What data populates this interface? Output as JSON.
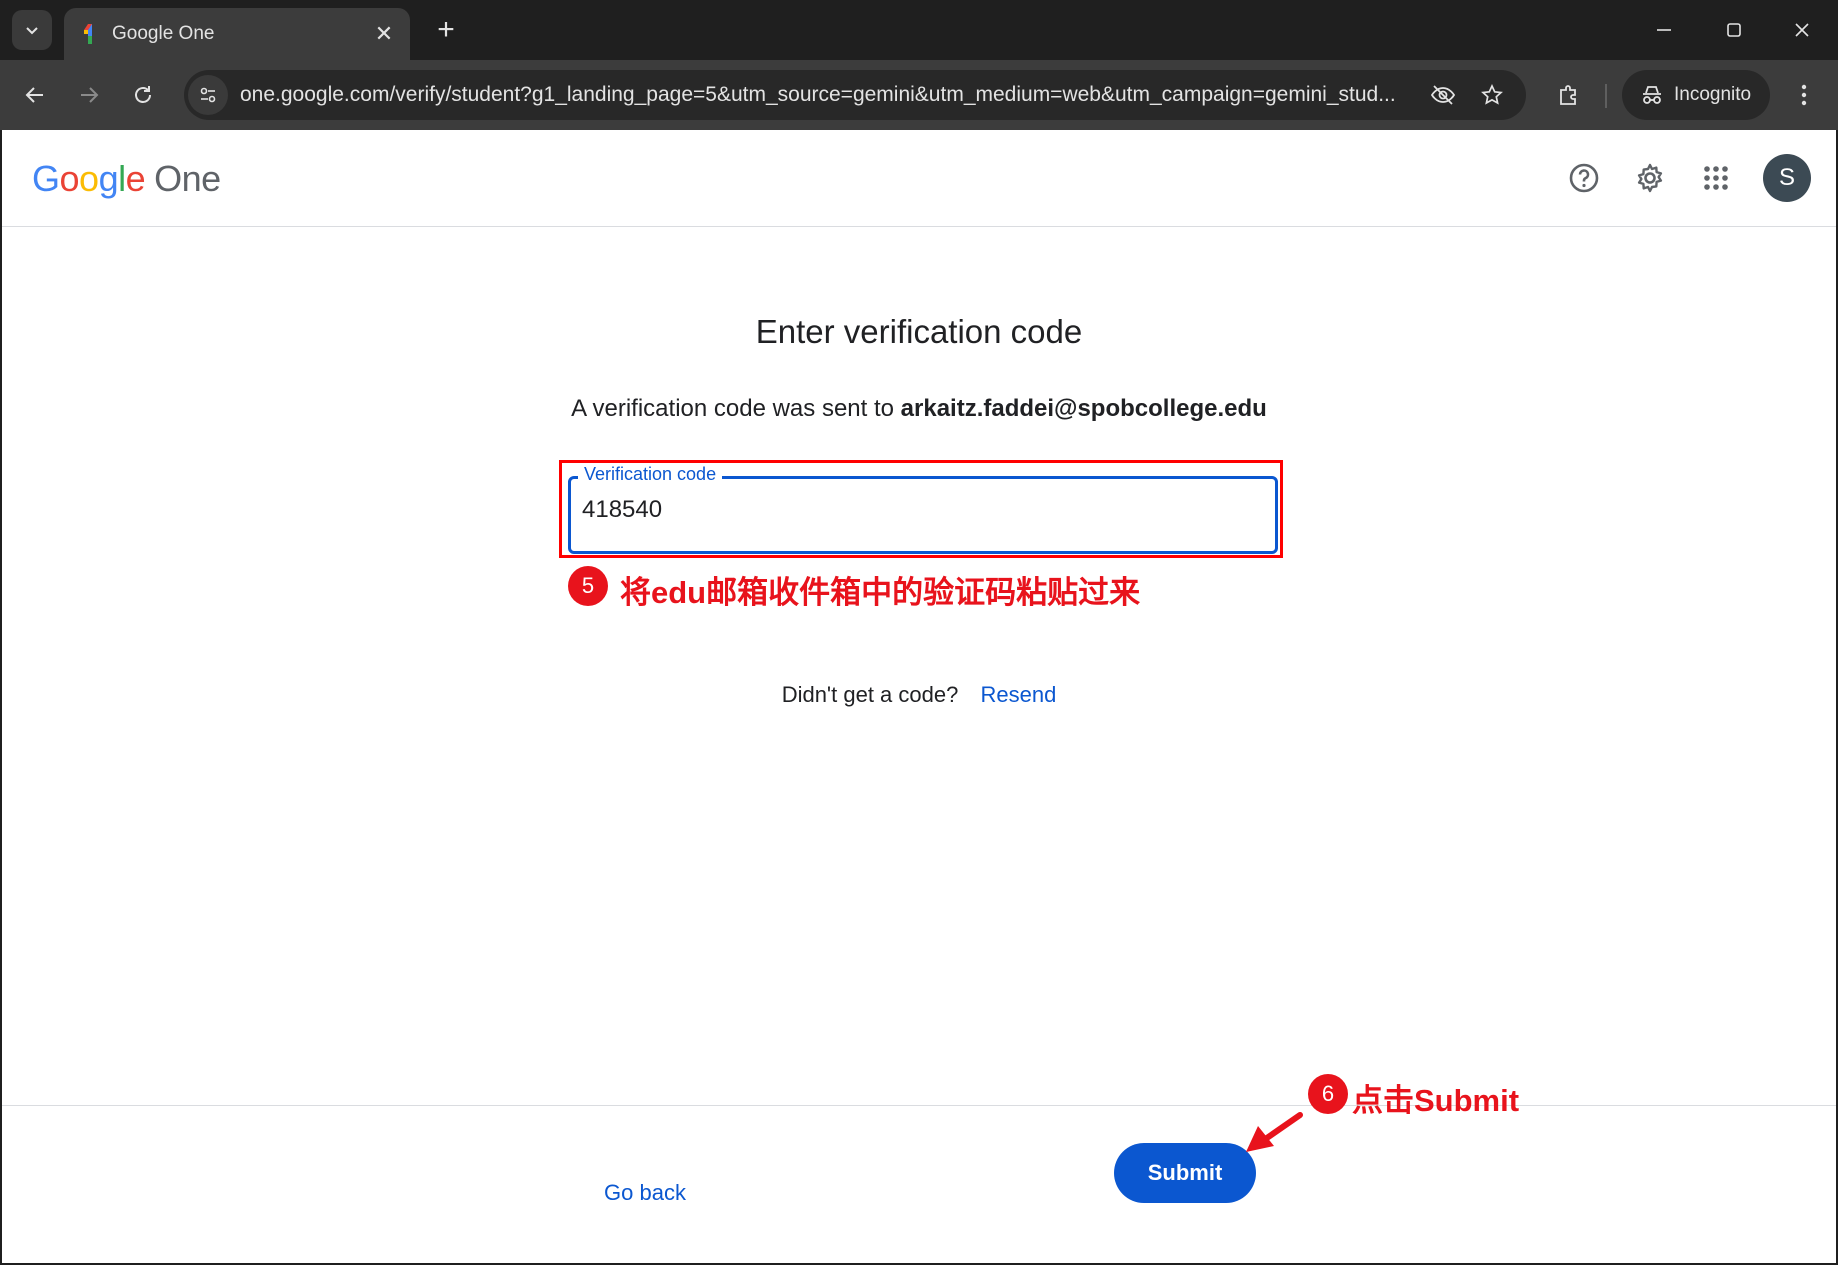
{
  "browser": {
    "tab_title": "Google One",
    "url": "one.google.com/verify/student?g1_landing_page=5&utm_source=gemini&utm_medium=web&utm_campaign=gemini_stud...",
    "incognito_label": "Incognito"
  },
  "header": {
    "logo_letters": [
      "G",
      "o",
      "o",
      "g",
      "l",
      "e"
    ],
    "logo_product": "One",
    "avatar_initial": "S"
  },
  "main": {
    "heading": "Enter verification code",
    "sent_prefix": "A verification code was sent to",
    "email": "arkaitz.faddei@spobcollege.edu",
    "field_label": "Verification code",
    "field_value": "418540",
    "resend_prompt": "Didn't get a code?",
    "resend_link": "Resend"
  },
  "footer": {
    "go_back": "Go back",
    "submit": "Submit"
  },
  "annotations": {
    "step5_number": "5",
    "step5_text": "将edu邮箱收件箱中的验证码粘贴过来",
    "step6_number": "6",
    "step6_text": "点击Submit"
  },
  "colors": {
    "accent_blue": "#0b57d0",
    "annotation_red": "#e8131c",
    "chrome_dark": "#3c3c3c"
  }
}
